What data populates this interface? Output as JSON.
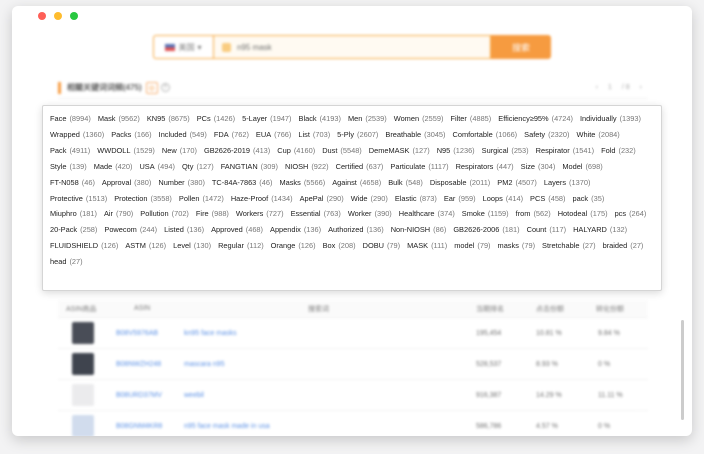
{
  "search": {
    "region": "美国",
    "query": "n95 mask",
    "button": "搜索"
  },
  "section": {
    "title": "相關关键词词频(475)",
    "page_current": "1",
    "page_total": "/ 8"
  },
  "keywords": [
    {
      "k": "Face",
      "c": "(8994)"
    },
    {
      "k": "Mask",
      "c": "(9562)"
    },
    {
      "k": "KN95",
      "c": "(8675)"
    },
    {
      "k": "PCs",
      "c": "(1426)"
    },
    {
      "k": "5-Layer",
      "c": "(1947)"
    },
    {
      "k": "Black",
      "c": "(4193)"
    },
    {
      "k": "Men",
      "c": "(2539)"
    },
    {
      "k": "Women",
      "c": "(2559)"
    },
    {
      "k": "Filter",
      "c": "(4885)"
    },
    {
      "k": "Efficiency≥95%",
      "c": "(4724)"
    },
    {
      "k": "Individually",
      "c": "(1393)"
    },
    {
      "k": "Wrapped",
      "c": "(1360)"
    },
    {
      "k": "Packs",
      "c": "(166)"
    },
    {
      "k": "Included",
      "c": "(549)"
    },
    {
      "k": "FDA",
      "c": "(762)"
    },
    {
      "k": "EUA",
      "c": "(766)"
    },
    {
      "k": "List",
      "c": "(703)"
    },
    {
      "k": "5-Ply",
      "c": "(2607)"
    },
    {
      "k": "Breathable",
      "c": "(3045)"
    },
    {
      "k": "Comfortable",
      "c": "(1066)"
    },
    {
      "k": "Safety",
      "c": "(2320)"
    },
    {
      "k": "White",
      "c": "(2084)"
    },
    {
      "k": "Pack",
      "c": "(4911)"
    },
    {
      "k": "WWDOLL",
      "c": "(1529)"
    },
    {
      "k": "New",
      "c": "(170)"
    },
    {
      "k": "GB2626-2019",
      "c": "(413)"
    },
    {
      "k": "Cup",
      "c": "(4160)"
    },
    {
      "k": "Dust",
      "c": "(5548)"
    },
    {
      "k": "DemeMASK",
      "c": "(127)"
    },
    {
      "k": "N95",
      "c": "(1236)"
    },
    {
      "k": "Surgical",
      "c": "(253)"
    },
    {
      "k": "Respirator",
      "c": "(1541)"
    },
    {
      "k": "Fold",
      "c": "(232)"
    },
    {
      "k": "Style",
      "c": "(139)"
    },
    {
      "k": "Made",
      "c": "(420)"
    },
    {
      "k": "USA",
      "c": "(494)"
    },
    {
      "k": "Qty",
      "c": "(127)"
    },
    {
      "k": "FANGTIAN",
      "c": "(309)"
    },
    {
      "k": "NIOSH",
      "c": "(922)"
    },
    {
      "k": "Certified",
      "c": "(637)"
    },
    {
      "k": "Particulate",
      "c": "(1117)"
    },
    {
      "k": "Respirators",
      "c": "(447)"
    },
    {
      "k": "Size",
      "c": "(304)"
    },
    {
      "k": "Model",
      "c": "(698)"
    },
    {
      "k": "FT-N058",
      "c": "(46)"
    },
    {
      "k": "Approval",
      "c": "(380)"
    },
    {
      "k": "Number",
      "c": "(380)"
    },
    {
      "k": "TC-84A-7863",
      "c": "(46)"
    },
    {
      "k": "Masks",
      "c": "(5566)"
    },
    {
      "k": "Against",
      "c": "(4658)"
    },
    {
      "k": "Bulk",
      "c": "(548)"
    },
    {
      "k": "Disposable",
      "c": "(2011)"
    },
    {
      "k": "PM2",
      "c": "(4507)"
    },
    {
      "k": "Layers",
      "c": "(1370)"
    },
    {
      "k": "Protective",
      "c": "(1513)"
    },
    {
      "k": "Protection",
      "c": "(3558)"
    },
    {
      "k": "Pollen",
      "c": "(1472)"
    },
    {
      "k": "Haze-Proof",
      "c": "(1434)"
    },
    {
      "k": "ApePal",
      "c": "(290)"
    },
    {
      "k": "Wide",
      "c": "(290)"
    },
    {
      "k": "Elastic",
      "c": "(873)"
    },
    {
      "k": "Ear",
      "c": "(959)"
    },
    {
      "k": "Loops",
      "c": "(414)"
    },
    {
      "k": "PCS",
      "c": "(458)"
    },
    {
      "k": "pack",
      "c": "(35)"
    },
    {
      "k": "Miuphro",
      "c": "(181)"
    },
    {
      "k": "Air",
      "c": "(790)"
    },
    {
      "k": "Pollution",
      "c": "(702)"
    },
    {
      "k": "Fire",
      "c": "(988)"
    },
    {
      "k": "Workers",
      "c": "(727)"
    },
    {
      "k": "Essential",
      "c": "(763)"
    },
    {
      "k": "Worker",
      "c": "(390)"
    },
    {
      "k": "Healthcare",
      "c": "(374)"
    },
    {
      "k": "Smoke",
      "c": "(1159)"
    },
    {
      "k": "from",
      "c": "(562)"
    },
    {
      "k": "Hotodeal",
      "c": "(175)"
    },
    {
      "k": "pcs",
      "c": "(264)"
    },
    {
      "k": "20-Pack",
      "c": "(258)"
    },
    {
      "k": "Powecom",
      "c": "(244)"
    },
    {
      "k": "Listed",
      "c": "(136)"
    },
    {
      "k": "Approved",
      "c": "(468)"
    },
    {
      "k": "Appendix",
      "c": "(136)"
    },
    {
      "k": "Authorized",
      "c": "(136)"
    },
    {
      "k": "Non-NIOSH",
      "c": "(86)"
    },
    {
      "k": "GB2626-2006",
      "c": "(181)"
    },
    {
      "k": "Count",
      "c": "(117)"
    },
    {
      "k": "HALYARD",
      "c": "(132)"
    },
    {
      "k": "FLUIDSHIELD",
      "c": "(126)"
    },
    {
      "k": "ASTM",
      "c": "(126)"
    },
    {
      "k": "Level",
      "c": "(130)"
    },
    {
      "k": "Regular",
      "c": "(112)"
    },
    {
      "k": "Orange",
      "c": "(126)"
    },
    {
      "k": "Box",
      "c": "(208)"
    },
    {
      "k": "DOBU",
      "c": "(79)"
    },
    {
      "k": "MASK",
      "c": "(111)"
    },
    {
      "k": "model",
      "c": "(79)"
    },
    {
      "k": "masks",
      "c": "(79)"
    },
    {
      "k": "Stretchable",
      "c": "(27)"
    },
    {
      "k": "braided",
      "c": "(27)"
    },
    {
      "k": "head",
      "c": "(27)"
    }
  ],
  "table": {
    "headers": [
      "ASIN商品",
      "ASIN",
      "搜索词",
      "当期排名",
      "点击份额",
      "转化份额"
    ],
    "rows": [
      {
        "asin": "B08V5976AB",
        "keyword": "kn95 face masks",
        "rank": "195,454",
        "click": "10.81 %",
        "conv": "9.84 %"
      },
      {
        "asin": "B08NWZH248",
        "keyword": "mascara n95",
        "rank": "528,537",
        "click": "8.93 %",
        "conv": "0 %"
      },
      {
        "asin": "B08URD37MV",
        "keyword": "weebil",
        "rank": "916,387",
        "click": "14.29 %",
        "conv": "11.11 %"
      },
      {
        "asin": "B08GNM4KR8",
        "keyword": "n95 face mask made in usa",
        "rank": "586,786",
        "click": "4.57 %",
        "conv": "0 %"
      }
    ]
  }
}
